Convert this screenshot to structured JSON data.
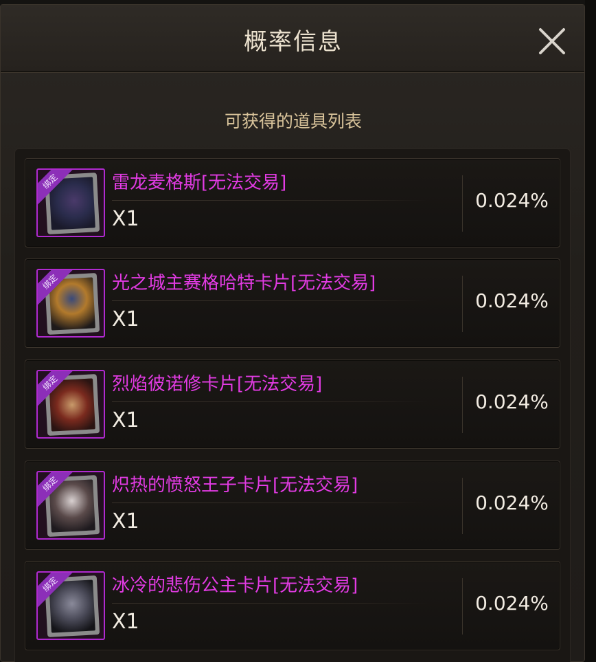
{
  "dialog": {
    "title": "概率信息",
    "subtitle": "可获得的道具列表"
  },
  "items": [
    {
      "name": "雷龙麦格斯[无法交易]",
      "quantity": "X1",
      "probability": "0.024%",
      "badge": "绑定",
      "art_colors": [
        "#2a2c4c",
        "#1a1a2a",
        "#4a3a6a"
      ]
    },
    {
      "name": "光之城主赛格哈特卡片[无法交易]",
      "quantity": "X1",
      "probability": "0.024%",
      "badge": "绑定",
      "art_colors": [
        "#b27a2c",
        "#3a4a7a",
        "#1e1a1a"
      ]
    },
    {
      "name": "烈焰彼诺修卡片[无法交易]",
      "quantity": "X1",
      "probability": "0.024%",
      "badge": "绑定",
      "art_colors": [
        "#7a2a1e",
        "#c89a6a",
        "#2a1412"
      ]
    },
    {
      "name": "炽热的愤怒王子卡片[无法交易]",
      "quantity": "X1",
      "probability": "0.024%",
      "badge": "绑定",
      "art_colors": [
        "#d8d0d0",
        "#5a4a4a",
        "#1e1a1e"
      ]
    },
    {
      "name": "冰冷的悲伤公主卡片[无法交易]",
      "quantity": "X1",
      "probability": "0.024%",
      "badge": "绑定",
      "art_colors": [
        "#4a4a58",
        "#8a8a9a",
        "#141418"
      ]
    }
  ],
  "colors": {
    "item_name": "#e23be3",
    "icon_border": "#b02ad0",
    "title": "#ece2cf",
    "subtitle": "#d8c39a"
  },
  "icons": {
    "close": "close-icon"
  }
}
